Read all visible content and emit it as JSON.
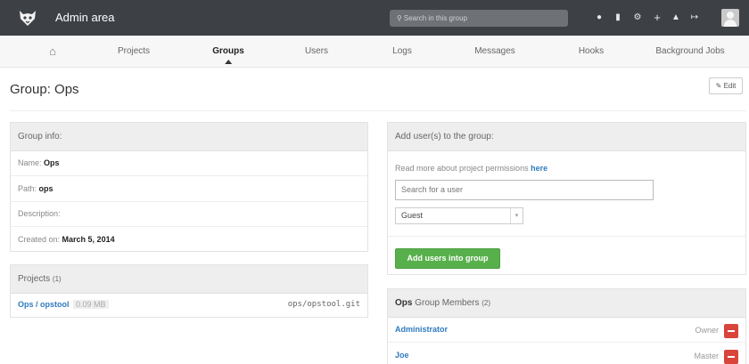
{
  "header": {
    "title": "Admin area",
    "search_placeholder": "Search in this group",
    "icons": [
      "globe-icon",
      "copy-icon",
      "gears-icon",
      "plus-icon",
      "user-icon",
      "logout-icon"
    ]
  },
  "nav": {
    "items": [
      {
        "label": "",
        "icon": "home-icon"
      },
      {
        "label": "Projects"
      },
      {
        "label": "Groups",
        "active": true
      },
      {
        "label": "Users"
      },
      {
        "label": "Logs"
      },
      {
        "label": "Messages"
      },
      {
        "label": "Hooks"
      },
      {
        "label": "Background Jobs"
      }
    ]
  },
  "page": {
    "title": "Group: Ops",
    "edit_label": "Edit"
  },
  "group_info": {
    "heading": "Group info:",
    "name_label": "Name:",
    "name_value": "Ops",
    "path_label": "Path:",
    "path_value": "ops",
    "description_label": "Description:",
    "created_label": "Created on:",
    "created_value": "March 5, 2014"
  },
  "projects": {
    "heading": "Projects",
    "count": "(1)",
    "items": [
      {
        "name": "Ops / opstool",
        "size": "0.09 MB",
        "path": "ops/opstool.git"
      }
    ]
  },
  "add_users": {
    "heading": "Add user(s) to the group:",
    "permissions_text": "Read more about project permissions",
    "permissions_link": "here",
    "search_placeholder": "Search for a user",
    "role_selected": "Guest",
    "button_label": "Add users into group"
  },
  "members": {
    "group_name": "Ops",
    "heading_suffix": "Group Members",
    "count": "(2)",
    "items": [
      {
        "name": "Administrator",
        "role": "Owner"
      },
      {
        "name": "Joe",
        "role": "Master"
      }
    ]
  },
  "colors": {
    "header_bg": "#3d4045",
    "link": "#2f7bbf",
    "add_button": "#58b04c",
    "remove_button": "#d9443b"
  }
}
